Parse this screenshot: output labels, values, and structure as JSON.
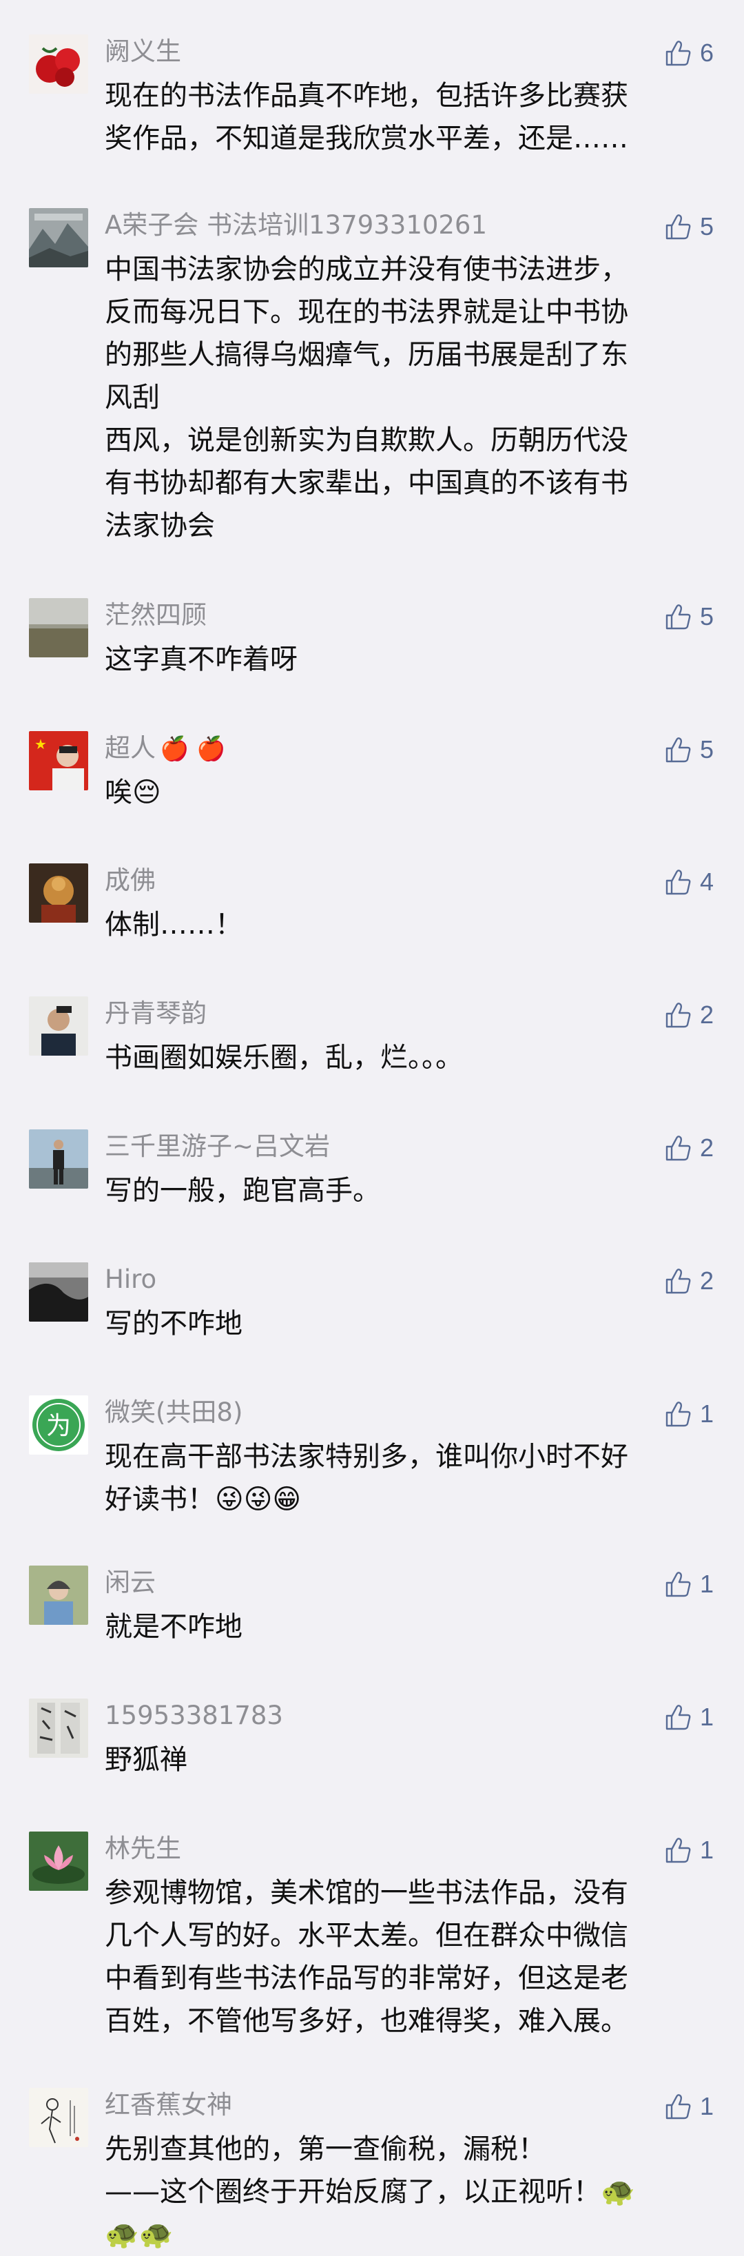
{
  "comments": [
    {
      "name": "阙义生",
      "likes": "6",
      "text": "现在的书法作品真不咋地，包括许多比赛获\n奖作品，不知道是我欣赏水平差，还是……",
      "avatar": "red-roses"
    },
    {
      "name": "A荣子会 书法培训13793310261",
      "likes": "5",
      "text": "中国书法家协会的成立并没有使书法进步，\n反而每况日下。现在的书法界就是让中书协\n的那些人搞得乌烟瘴气，历届书展是刮了东\n风刮\n西风，说是创新实为自欺欺人。历朝历代没\n有书协却都有大家辈出，中国真的不该有书\n法家协会",
      "avatar": "landscape-painting"
    },
    {
      "name": "茫然四顾",
      "likes": "5",
      "text": "这字真不咋着呀",
      "avatar": "grey-field"
    },
    {
      "name": "超人",
      "name_suffix": "🍎 🍎",
      "likes": "5",
      "text": "唉😔",
      "avatar": "flag-portrait"
    },
    {
      "name": "成佛",
      "likes": "4",
      "text": "体制……！",
      "avatar": "buddha"
    },
    {
      "name": "丹青琴韵",
      "likes": "2",
      "text": "书画圈如娱乐圈，乱，烂。。。",
      "avatar": "man-portrait"
    },
    {
      "name": "三千里游子~吕文岩",
      "likes": "2",
      "text": "写的一般，跑官高手。",
      "avatar": "standing-man"
    },
    {
      "name": "Hiro",
      "likes": "2",
      "text": "写的不咋地",
      "avatar": "dark-coast"
    },
    {
      "name": "微笑(共田8)",
      "likes": "1",
      "text": "现在高干部书法家特别多，谁叫你小时不好\n好读书！😜😜😁",
      "avatar": "green-logo"
    },
    {
      "name": "闲云",
      "likes": "1",
      "text": "就是不咋地",
      "avatar": "woman-outdoor"
    },
    {
      "name": "15953381783",
      "likes": "1",
      "text": "野狐禅",
      "avatar": "calligraphy-scroll"
    },
    {
      "name": "林先生",
      "likes": "1",
      "text": "参观博物馆，美术馆的一些书法作品，没有\n几个人写的好。水平太差。但在群众中微信\n中看到有些书法作品写的非常好，但这是老\n百姓，不管他写多好，也难得奖，难入展。",
      "avatar": "lotus"
    },
    {
      "name": "红香蕉女神",
      "likes": "1",
      "text": "先别查其他的，第一查偷税，漏税！\n——这个圈终于开始反腐了，以正视听！🐢\n🐢🐢",
      "avatar": "ink-figure"
    }
  ],
  "icons": {
    "like": "thumbs-up-icon"
  },
  "colors": {
    "background": "#f2f1f5",
    "name": "#8e8e93",
    "text": "#111111",
    "like": "#576b95"
  }
}
